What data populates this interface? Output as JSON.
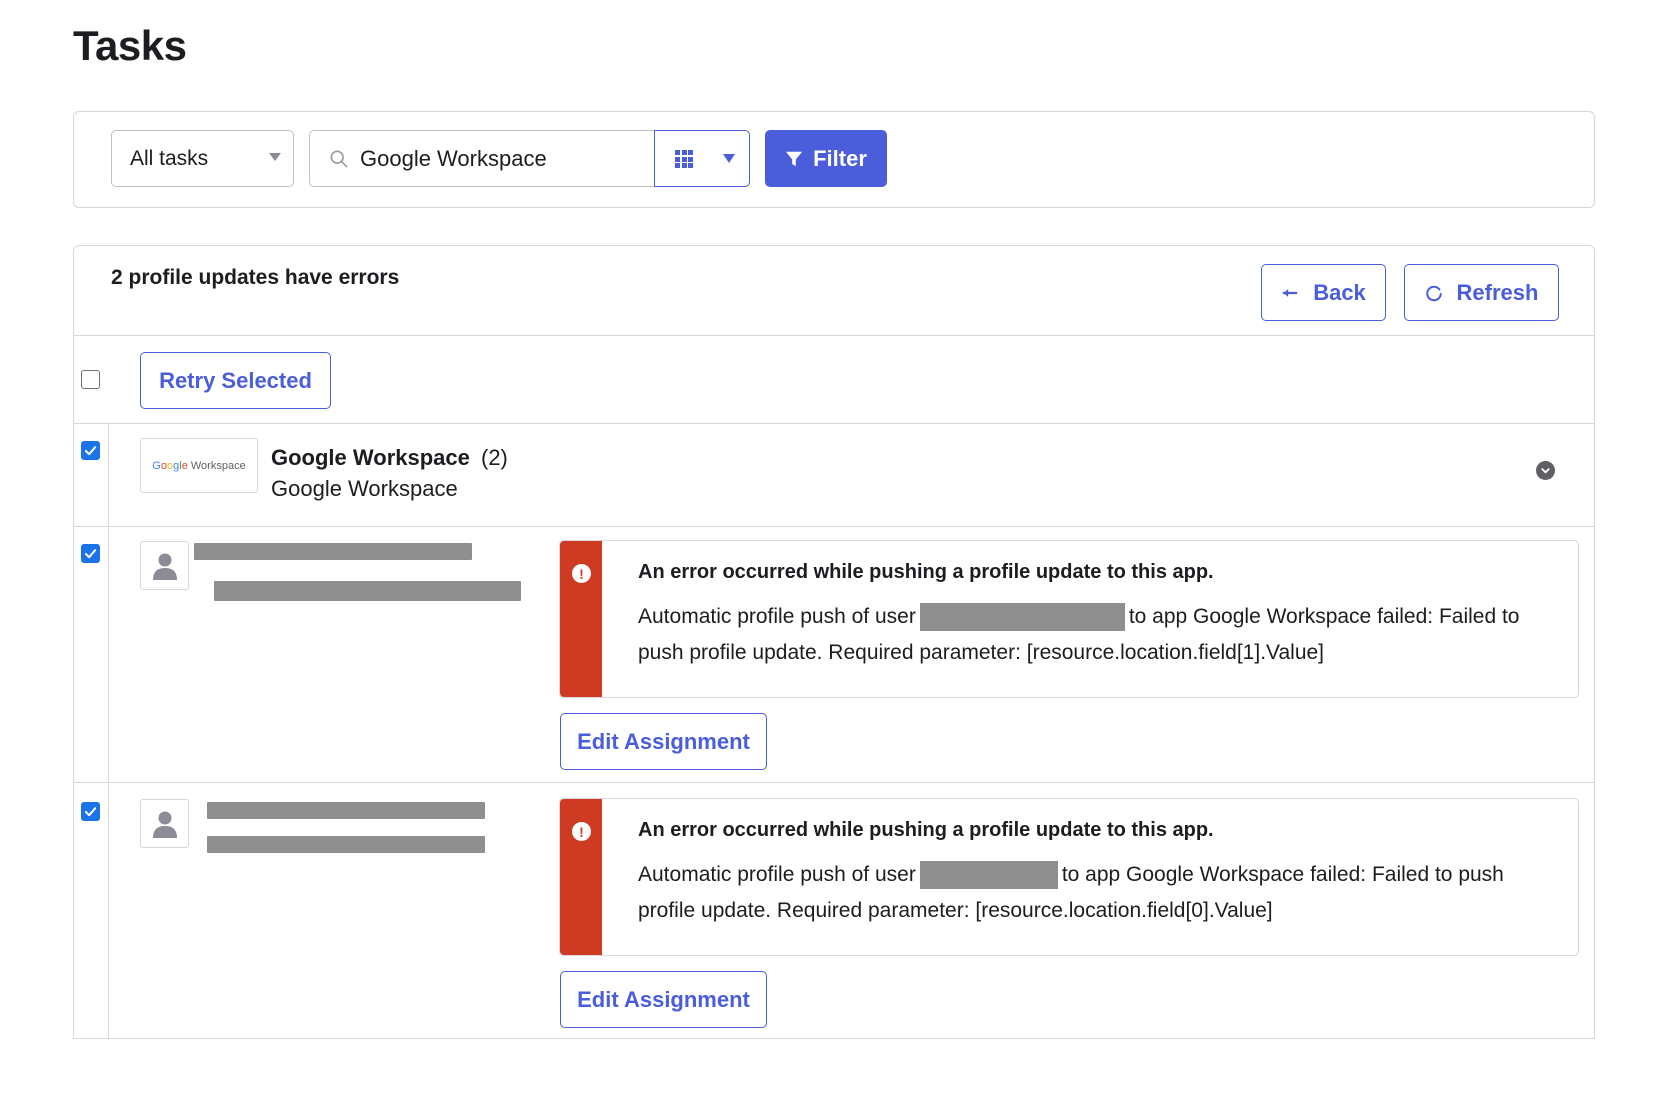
{
  "page": {
    "title": "Tasks"
  },
  "toolbar": {
    "task_filter": "All tasks",
    "search_value": "Google Workspace",
    "filter_label": "Filter"
  },
  "results": {
    "summary": "2 profile updates have errors",
    "back_label": "Back",
    "refresh_label": "Refresh",
    "retry_label": "Retry Selected",
    "select_all_checked": false
  },
  "app_group": {
    "name": "Google Workspace",
    "count": "(2)",
    "subtitle": "Google Workspace",
    "checked": true,
    "logo": {
      "google": [
        "G",
        "o",
        "o",
        "g",
        "l",
        "e"
      ],
      "workspace": "Workspace"
    }
  },
  "tasks": [
    {
      "checked": true,
      "error_title": "An error occurred while pushing a profile update to this app.",
      "msg_prefix": "Automatic profile push of user",
      "msg_suffix": "to app Google Workspace failed: Failed to push profile update. Required parameter: [resource.location.field[1].Value]",
      "action_label": "Edit Assignment"
    },
    {
      "checked": true,
      "error_title": "An error occurred while pushing a profile update to this app.",
      "msg_prefix": "Automatic profile push of user",
      "msg_suffix": "to app Google Workspace failed: Failed to push profile update. Required parameter: [resource.location.field[0].Value]",
      "action_label": "Edit Assignment"
    }
  ],
  "colors": {
    "accent": "#4a5ddb",
    "error": "#cf3b22",
    "checkbox": "#1a73e8",
    "redaction": "#8f8f8f"
  }
}
